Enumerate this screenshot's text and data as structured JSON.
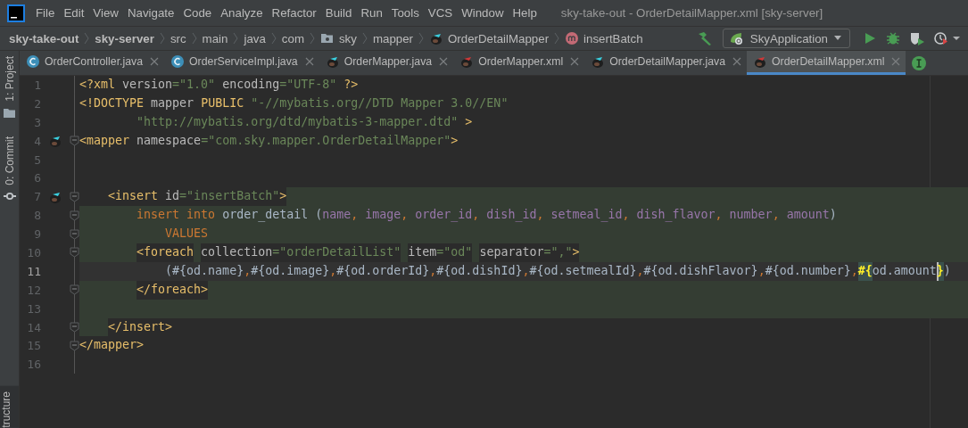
{
  "menu_bar": {
    "items": [
      "File",
      "Edit",
      "View",
      "Navigate",
      "Code",
      "Analyze",
      "Refactor",
      "Build",
      "Run",
      "Tools",
      "VCS",
      "Window",
      "Help"
    ],
    "title": "sky-take-out - OrderDetailMapper.xml [sky-server]"
  },
  "breadcrumb": [
    {
      "label": "sky-take-out",
      "bold": true,
      "kind": "module"
    },
    {
      "label": "sky-server",
      "bold": true,
      "kind": "module"
    },
    {
      "label": "src",
      "bold": false,
      "kind": "dir"
    },
    {
      "label": "main",
      "bold": false,
      "kind": "dir"
    },
    {
      "label": "java",
      "bold": false,
      "kind": "dir"
    },
    {
      "label": "com",
      "bold": false,
      "kind": "dir"
    },
    {
      "label": "sky",
      "bold": false,
      "kind": "package"
    },
    {
      "label": "mapper",
      "bold": false,
      "kind": "dir"
    },
    {
      "label": "OrderDetailMapper",
      "bold": false,
      "kind": "mapper"
    },
    {
      "label": "insertBatch",
      "bold": false,
      "kind": "method"
    }
  ],
  "run_config": {
    "label": "SkyApplication"
  },
  "side_tools": [
    {
      "label": "1: Project",
      "kind": "project"
    },
    {
      "label": "0: Commit",
      "kind": "commit"
    }
  ],
  "side_tools_bottom": [
    {
      "label": "tructure"
    }
  ],
  "tabs": [
    {
      "label": "OrderController.java",
      "kind": "class",
      "selected": false
    },
    {
      "label": "OrderServiceImpl.java",
      "kind": "class",
      "selected": false
    },
    {
      "label": "OrderMapper.java",
      "kind": "mapper",
      "selected": false
    },
    {
      "label": "OrderMapper.xml",
      "kind": "xml",
      "selected": false
    },
    {
      "label": "OrderDetailMapper.java",
      "kind": "mapper",
      "selected": false
    },
    {
      "label": "OrderDetailMapper.xml",
      "kind": "xml",
      "selected": true
    }
  ],
  "editor": {
    "lines": [
      {
        "number": "1",
        "gutter_icon": false,
        "fold": false,
        "kind": "plain",
        "tokens": [
          {
            "text": "<?xml",
            "kind": "tag"
          },
          {
            "text": " version",
            "kind": "attr"
          },
          {
            "text": "=\"1.0\"",
            "kind": "str"
          },
          {
            "text": " encoding",
            "kind": "attr"
          },
          {
            "text": "=\"UTF-8\"",
            "kind": "str"
          },
          {
            "text": " ?>",
            "kind": "tag"
          }
        ]
      },
      {
        "number": "2",
        "gutter_icon": false,
        "fold": false,
        "kind": "plain",
        "tokens": [
          {
            "text": "<!DOCTYPE",
            "kind": "tag"
          },
          {
            "text": " mapper ",
            "kind": "attr"
          },
          {
            "text": "PUBLIC",
            "kind": "tag"
          },
          {
            "text": " \"-//mybatis.org//DTD Mapper 3.0//EN\"",
            "kind": "str"
          }
        ]
      },
      {
        "number": "3",
        "gutter_icon": false,
        "fold": false,
        "kind": "plain",
        "tokens": [
          {
            "text": "        \"http://mybatis.org/dtd/mybatis-3-mapper.dtd\"",
            "kind": "str"
          },
          {
            "text": " >",
            "kind": "tag"
          }
        ]
      },
      {
        "number": "4",
        "gutter_icon": true,
        "fold": true,
        "kind": "plain",
        "tokens": [
          {
            "text": "<mapper",
            "kind": "tag"
          },
          {
            "text": " namespace",
            "kind": "attr"
          },
          {
            "text": "=\"com.sky.mapper.OrderDetailMapper\"",
            "kind": "str"
          },
          {
            "text": ">",
            "kind": "tag"
          }
        ]
      },
      {
        "number": "5",
        "gutter_icon": false,
        "fold": false,
        "kind": "plain"
      },
      {
        "number": "6",
        "gutter_icon": false,
        "fold": false,
        "kind": "plain"
      },
      {
        "number": "7",
        "gutter_icon": true,
        "fold": true,
        "kind": "tail",
        "tokens": [
          {
            "text": "    <insert",
            "kind": "tag"
          },
          {
            "text": " id",
            "kind": "attr"
          },
          {
            "text": "=\"insertBatch\"",
            "kind": "str"
          },
          {
            "text": ">",
            "kind": "tag"
          }
        ]
      },
      {
        "number": "8",
        "gutter_icon": false,
        "fold": true,
        "kind": "injected",
        "tokens": [
          {
            "text": "        insert into",
            "kind": "kw"
          },
          {
            "text": " order_detail (",
            "kind": "plain"
          },
          {
            "text": "name",
            "kind": "col"
          },
          {
            "text": ", ",
            "kind": "punct"
          },
          {
            "text": "image",
            "kind": "col"
          },
          {
            "text": ", ",
            "kind": "punct"
          },
          {
            "text": "order_id",
            "kind": "col"
          },
          {
            "text": ", ",
            "kind": "punct"
          },
          {
            "text": "dish_id",
            "kind": "col"
          },
          {
            "text": ", ",
            "kind": "punct"
          },
          {
            "text": "setmeal_id",
            "kind": "col"
          },
          {
            "text": ", ",
            "kind": "punct"
          },
          {
            "text": "dish_flavor",
            "kind": "col"
          },
          {
            "text": ", ",
            "kind": "punct"
          },
          {
            "text": "number",
            "kind": "col"
          },
          {
            "text": ", ",
            "kind": "punct"
          },
          {
            "text": "amount",
            "kind": "col"
          },
          {
            "text": ")",
            "kind": "plain"
          }
        ]
      },
      {
        "number": "9",
        "gutter_icon": false,
        "fold": true,
        "kind": "injected",
        "tokens": [
          {
            "text": "            VALUES",
            "kind": "kw"
          }
        ]
      },
      {
        "number": "10",
        "gutter_icon": false,
        "fold": true,
        "kind": "injected",
        "tokens": [
          {
            "text": "        <foreach",
            "kind": "tag"
          },
          {
            "text": " collection",
            "kind": "attr"
          },
          {
            "text": "=\"orderDetailList\"",
            "kind": "str"
          },
          {
            "text": " item",
            "kind": "attr"
          },
          {
            "text": "=\"od\"",
            "kind": "str"
          },
          {
            "text": " separator",
            "kind": "attr"
          },
          {
            "text": "=\",\"",
            "kind": "str"
          },
          {
            "text": ">",
            "kind": "tag"
          }
        ]
      },
      {
        "number": "11",
        "gutter_icon": false,
        "fold": false,
        "kind": "current",
        "tokens": [
          {
            "text": "            (#{od.name}",
            "kind": "plain"
          },
          {
            "text": ",",
            "kind": "punct"
          },
          {
            "text": "#{od.image}",
            "kind": "plain"
          },
          {
            "text": ",",
            "kind": "punct"
          },
          {
            "text": "#{od.orderId}",
            "kind": "plain"
          },
          {
            "text": ",",
            "kind": "punct"
          },
          {
            "text": "#{od.dishId}",
            "kind": "plain"
          },
          {
            "text": ",",
            "kind": "punct"
          },
          {
            "text": "#{od.setmealId}",
            "kind": "plain"
          },
          {
            "text": ",",
            "kind": "punct"
          },
          {
            "text": "#{od.dishFlavor}",
            "kind": "plain"
          },
          {
            "text": ",",
            "kind": "punct"
          },
          {
            "text": "#{od.number}",
            "kind": "plain"
          },
          {
            "text": ",",
            "kind": "punct"
          },
          {
            "text": "#{",
            "kind": "match"
          },
          {
            "text": "od.amount",
            "kind": "plain"
          },
          {
            "text": "}",
            "kind": "caret"
          },
          {
            "text": ")",
            "kind": "plain"
          }
        ]
      },
      {
        "number": "12",
        "gutter_icon": false,
        "fold": true,
        "kind": "injected",
        "tokens": [
          {
            "text": "        </foreach>",
            "kind": "tag"
          }
        ]
      },
      {
        "number": "13",
        "gutter_icon": false,
        "fold": false,
        "kind": "injected"
      },
      {
        "number": "14",
        "gutter_icon": false,
        "fold": true,
        "kind": "head",
        "tokens": [
          {
            "text": "    </insert>",
            "kind": "tag"
          }
        ]
      },
      {
        "number": "15",
        "gutter_icon": false,
        "fold": true,
        "kind": "plain",
        "tokens": [
          {
            "text": "</mapper>",
            "kind": "tag"
          }
        ]
      },
      {
        "number": "16",
        "gutter_icon": false,
        "fold": false,
        "kind": "plain"
      }
    ]
  }
}
